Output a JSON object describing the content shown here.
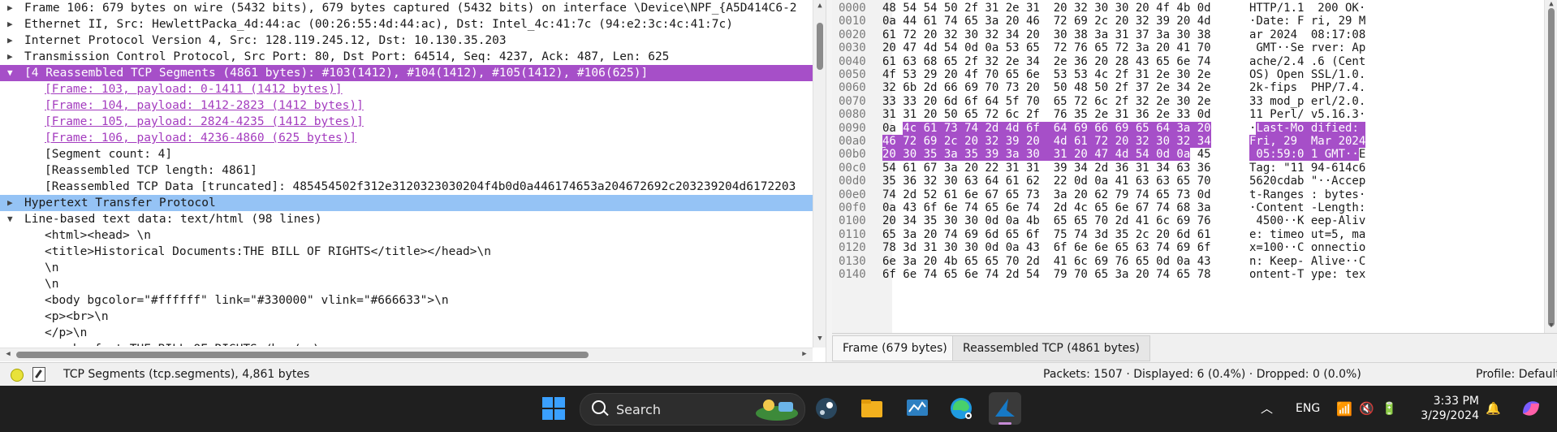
{
  "detail_rows": [
    {
      "text": "Frame 106: 679 bytes on wire (5432 bits), 679 bytes captured (5432 bits) on interface \\Device\\NPF_{A5D414C6-2",
      "twisty": "▶",
      "level": 0,
      "style": ""
    },
    {
      "text": "Ethernet II, Src: HewlettPacka_4d:44:ac (00:26:55:4d:44:ac), Dst: Intel_4c:41:7c (94:e2:3c:4c:41:7c)",
      "twisty": "▶",
      "level": 0,
      "style": ""
    },
    {
      "text": "Internet Protocol Version 4, Src: 128.119.245.12, Dst: 10.130.35.203",
      "twisty": "▶",
      "level": 0,
      "style": ""
    },
    {
      "text": "Transmission Control Protocol, Src Port: 80, Dst Port: 64514, Seq: 4237, Ack: 487, Len: 625",
      "twisty": "▶",
      "level": 0,
      "style": ""
    },
    {
      "text": "[4 Reassembled TCP Segments (4861 bytes): #103(1412), #104(1412), #105(1412), #106(625)]",
      "twisty": "▼",
      "level": 0,
      "style": "sel-purple"
    },
    {
      "text": "[Frame: 103, payload: 0-1411 (1412 bytes)]",
      "twisty": "",
      "level": 1,
      "style": "link"
    },
    {
      "text": "[Frame: 104, payload: 1412-2823 (1412 bytes)]",
      "twisty": "",
      "level": 1,
      "style": "link"
    },
    {
      "text": "[Frame: 105, payload: 2824-4235 (1412 bytes)]",
      "twisty": "",
      "level": 1,
      "style": "link"
    },
    {
      "text": "[Frame: 106, payload: 4236-4860 (625 bytes)]",
      "twisty": "",
      "level": 1,
      "style": "link"
    },
    {
      "text": "[Segment count: 4]",
      "twisty": "",
      "level": 1,
      "style": ""
    },
    {
      "text": "[Reassembled TCP length: 4861]",
      "twisty": "",
      "level": 1,
      "style": ""
    },
    {
      "text": "[Reassembled TCP Data [truncated]: 485454502f312e3120323030204f4b0d0a446174653a204672692c203239204d6172203",
      "twisty": "",
      "level": 1,
      "style": ""
    },
    {
      "text": "Hypertext Transfer Protocol",
      "twisty": "▶",
      "level": 0,
      "style": "sel-blue"
    },
    {
      "text": "Line-based text data: text/html (98 lines)",
      "twisty": "▼",
      "level": 0,
      "style": ""
    },
    {
      "text": "<html><head> \\n",
      "twisty": "",
      "level": 1,
      "style": ""
    },
    {
      "text": "<title>Historical Documents:THE BILL OF RIGHTS</title></head>\\n",
      "twisty": "",
      "level": 1,
      "style": ""
    },
    {
      "text": "\\n",
      "twisty": "",
      "level": 1,
      "style": ""
    },
    {
      "text": "\\n",
      "twisty": "",
      "level": 1,
      "style": ""
    },
    {
      "text": "<body bgcolor=\"#ffffff\" link=\"#330000\" vlink=\"#666633\">\\n",
      "twisty": "",
      "level": 1,
      "style": ""
    },
    {
      "text": "<p><br>\\n",
      "twisty": "",
      "level": 1,
      "style": ""
    },
    {
      "text": "</p>\\n",
      "twisty": "",
      "level": 1,
      "style": ""
    },
    {
      "text": "<p><b><font>THE BILL OF RIGHTS</b></p>\\n",
      "twisty": "",
      "level": 1,
      "style": ""
    }
  ],
  "byte_rows": [
    {
      "off": "0000",
      "hex": "48 54 54 50 2f 31 2e 31  20 32 30 30 20 4f 4b 0d",
      "ascii": "HTTP/1.1  200 OK·",
      "hl": "none"
    },
    {
      "off": "0010",
      "hex": "0a 44 61 74 65 3a 20 46  72 69 2c 20 32 39 20 4d",
      "ascii": "·Date: F ri, 29 M",
      "hl": "none"
    },
    {
      "off": "0020",
      "hex": "61 72 20 32 30 32 34 20  30 38 3a 31 37 3a 30 38",
      "ascii": "ar 2024  08:17:08",
      "hl": "none"
    },
    {
      "off": "0030",
      "hex": "20 47 4d 54 0d 0a 53 65  72 76 65 72 3a 20 41 70",
      "ascii": " GMT··Se rver: Ap",
      "hl": "none"
    },
    {
      "off": "0040",
      "hex": "61 63 68 65 2f 32 2e 34  2e 36 20 28 43 65 6e 74",
      "ascii": "ache/2.4 .6 (Cent",
      "hl": "none"
    },
    {
      "off": "0050",
      "hex": "4f 53 29 20 4f 70 65 6e  53 53 4c 2f 31 2e 30 2e",
      "ascii": "OS) Open SSL/1.0.",
      "hl": "none"
    },
    {
      "off": "0060",
      "hex": "32 6b 2d 66 69 70 73 20  50 48 50 2f 37 2e 34 2e",
      "ascii": "2k-fips  PHP/7.4.",
      "hl": "none"
    },
    {
      "off": "0070",
      "hex": "33 33 20 6d 6f 64 5f 70  65 72 6c 2f 32 2e 30 2e",
      "ascii": "33 mod_p erl/2.0.",
      "hl": "none"
    },
    {
      "off": "0080",
      "hex": "31 31 20 50 65 72 6c 2f  76 35 2e 31 36 2e 33 0d",
      "ascii": "11 Perl/ v5.16.3·",
      "hl": "none"
    },
    {
      "off": "0090",
      "hex": "0a 4c 61 73 74 2d 4d 6f  64 69 66 69 65 64 3a 20",
      "ascii": "·Last-Mo dified: ",
      "hl": "partial"
    },
    {
      "off": "00a0",
      "hex": "46 72 69 2c 20 32 39 20  4d 61 72 20 32 30 32 34",
      "ascii": "Fri, 29  Mar 2024",
      "hl": "full"
    },
    {
      "off": "00b0",
      "hex": "20 30 35 3a 35 39 3a 30  31 20 47 4d 54 0d 0a 45",
      "ascii": " 05:59:0 1 GMT··E",
      "hl": "end"
    },
    {
      "off": "00c0",
      "hex": "54 61 67 3a 20 22 31 31  39 34 2d 36 31 34 63 36",
      "ascii": "Tag: \"11 94-614c6",
      "hl": "none"
    },
    {
      "off": "00d0",
      "hex": "35 36 32 30 63 64 61 62  22 0d 0a 41 63 63 65 70",
      "ascii": "5620cdab \"··Accep",
      "hl": "none"
    },
    {
      "off": "00e0",
      "hex": "74 2d 52 61 6e 67 65 73  3a 20 62 79 74 65 73 0d",
      "ascii": "t-Ranges : bytes·",
      "hl": "none"
    },
    {
      "off": "00f0",
      "hex": "0a 43 6f 6e 74 65 6e 74  2d 4c 65 6e 67 74 68 3a",
      "ascii": "·Content -Length:",
      "hl": "none"
    },
    {
      "off": "0100",
      "hex": "20 34 35 30 30 0d 0a 4b  65 65 70 2d 41 6c 69 76",
      "ascii": " 4500··K eep-Aliv",
      "hl": "none"
    },
    {
      "off": "0110",
      "hex": "65 3a 20 74 69 6d 65 6f  75 74 3d 35 2c 20 6d 61",
      "ascii": "e: timeo ut=5, ma",
      "hl": "none"
    },
    {
      "off": "0120",
      "hex": "78 3d 31 30 30 0d 0a 43  6f 6e 6e 65 63 74 69 6f",
      "ascii": "x=100··C onnectio",
      "hl": "none"
    },
    {
      "off": "0130",
      "hex": "6e 3a 20 4b 65 65 70 2d  41 6c 69 76 65 0d 0a 43",
      "ascii": "n: Keep- Alive··C",
      "hl": "none"
    },
    {
      "off": "0140",
      "hex": "6f 6e 74 65 6e 74 2d 54  79 70 65 3a 20 74 65 78",
      "ascii": "ontent-T ype: tex",
      "hl": "none"
    }
  ],
  "bytes_tabs": [
    "Frame (679 bytes)",
    "Reassembled TCP (4861 bytes)"
  ],
  "status": {
    "field_info": "TCP Segments (tcp.segments), 4,861 bytes",
    "packets": "Packets: 1507 · Displayed: 6 (0.4%) · Dropped: 0 (0.0%)",
    "profile": "Profile: Default"
  },
  "taskbar": {
    "search_label": "Search",
    "lang": "ENG",
    "time": "3:33 PM",
    "date": "3/29/2024"
  },
  "colors": {
    "selection_purple": "#a64fc8",
    "selection_blue": "#95c3f5",
    "taskbar_bg": "#1f1f1f"
  }
}
